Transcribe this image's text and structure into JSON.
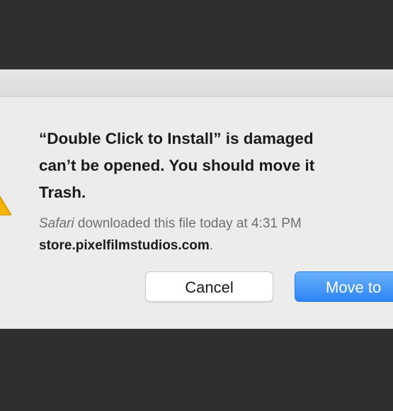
{
  "dialog": {
    "headline_lines": [
      "“Double Click to Install” is damaged",
      "can’t be opened. You should move it",
      "Trash."
    ],
    "detail": {
      "app": "Safari",
      "line1_rest": " downloaded this file today at 4:31 PM",
      "domain": "store.pixelfilmstudios.com",
      "domain_suffix": "."
    },
    "buttons": {
      "cancel": "Cancel",
      "move": "Move to"
    },
    "icon": "warning-triangle-icon"
  },
  "colors": {
    "background": "#2f2f2f",
    "dialog": "#ececec",
    "accent": "#2d84f5",
    "warning": "#f5b400"
  }
}
